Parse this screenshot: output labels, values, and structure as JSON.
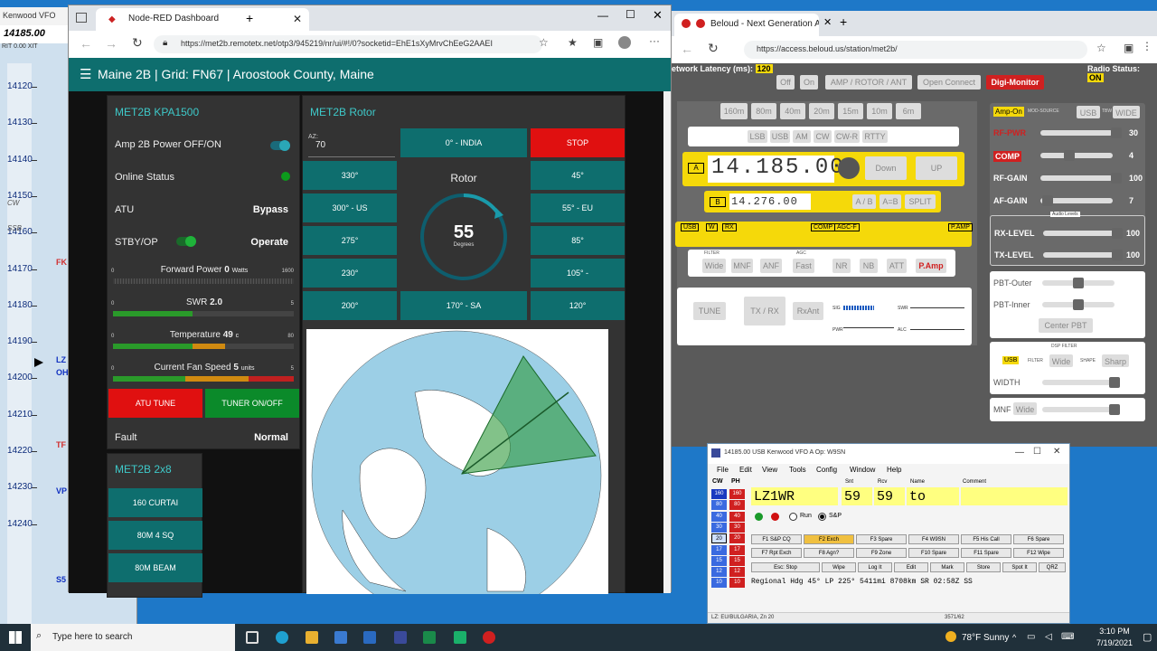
{
  "bandmap": {
    "title": "Kenwood VFO",
    "freq": "14185.00",
    "labels": [
      "RIT",
      "0.00",
      "XIT",
      "0.00"
    ],
    "mhz": [
      "14120",
      "14130",
      "14140",
      "14150",
      "14160",
      "14170",
      "14180",
      "14190",
      "14200",
      "14210",
      "14220",
      "14230",
      "14240"
    ],
    "mode_labels": {
      "cw": "CW",
      "ssb": "SSB"
    },
    "spots": [
      "FK",
      "LZ",
      "OH",
      "TF",
      "VP",
      "S5"
    ]
  },
  "left_browser": {
    "tab_title": "Node-RED Dashboard",
    "url": "https://met2b.remotetx.net/otp3/945219/nr/ui/#!/0?socketid=EhE1sXyMrvChEeG2AAEI",
    "header": "Maine 2B | Grid: FN67 | Aroostook County, Maine",
    "kpa": {
      "title": "MET2B KPA1500",
      "power_label": "Amp 2B Power OFF/ON",
      "online_label": "Online Status",
      "atu_label": "ATU",
      "atu_value": "Bypass",
      "stby_label": "STBY/OP",
      "stby_value": "Operate",
      "fwd_label": "Forward Power",
      "fwd_value": "0",
      "fwd_unit": "Watts",
      "fwd_min": "0",
      "fwd_max": "1600",
      "swr_label": "SWR",
      "swr_value": "2.0",
      "swr_min": "0",
      "swr_max": "5",
      "temp_label": "Temperature",
      "temp_value": "49",
      "temp_unit": "c",
      "temp_min": "0",
      "temp_max": "80",
      "fan_label": "Current Fan Speed",
      "fan_value": "5",
      "fan_unit": "units",
      "fan_min": "0",
      "fan_max": "5",
      "atu_tune": "ATU TUNE",
      "tuner_onoff": "TUNER ON/OFF",
      "fault_label": "Fault",
      "fault_value": "Normal"
    },
    "rotor": {
      "title": "MET2B Rotor",
      "az_label": "AZ:",
      "az_value": "70",
      "center_label": "Rotor",
      "degrees": "55",
      "degrees_unit": "Degrees",
      "stop": "STOP",
      "buttons": [
        "0° - INDIA",
        "330°",
        "45°",
        "300° - US",
        "55° - EU",
        "275°",
        "85°",
        "230°",
        "105° -",
        "200°",
        "170° - SA",
        "120°"
      ]
    },
    "switch": {
      "title": "MET2B 2x8",
      "items": [
        "160 CURTAI",
        "80M 4 SQ",
        "80M BEAM"
      ]
    }
  },
  "right_browser": {
    "tab_title": "Beloud - Next Generation A",
    "url": "https://access.beloud.us/station/met2b/",
    "latency_label": "etwork Latency (ms):",
    "latency_value": "120",
    "radio_status_label": "Radio Status:",
    "radio_status_value": "ON",
    "top_buttons": [
      "Off",
      "On",
      "AMP / ROTOR / ANT",
      "Open Connect",
      "Digi-Monitor"
    ],
    "bands": [
      "160m",
      "80m",
      "40m",
      "20m",
      "15m",
      "10m",
      "6m"
    ],
    "modes": [
      "LSB",
      "USB",
      "AM",
      "CW",
      "CW-R",
      "RTTY"
    ],
    "vfo_a_label": "A",
    "vfo_a_freq": "14.185.00",
    "down": "Down",
    "up": "UP",
    "vfo_b_label": "B",
    "vfo_b_freq": "14.276.00",
    "ab_buttons": [
      "A / B",
      "A=B",
      "SPLIT"
    ],
    "status_flags": [
      "USB",
      "W",
      "RX",
      "COMP",
      "AGC-F",
      "P.AMP"
    ],
    "filter_label": "FILTER",
    "agc_label": "AGC",
    "filter_buttons": [
      "Wide",
      "MNF",
      "ANF",
      "Fast",
      "NR",
      "NB",
      "ATT",
      "P.Amp"
    ],
    "tx_buttons": [
      "TUNE",
      "TX / RX",
      "RxAnt"
    ],
    "meter_labels": [
      "SIG",
      "PWR",
      "SWR",
      "ALC"
    ],
    "amp_on": "Amp-On",
    "mod_source": "MOD-SOURCE",
    "mod_value": "USB",
    "tbw": "TBW",
    "tbw_value": "WIDE",
    "controls": [
      {
        "label": "RF-PWR",
        "value": "30"
      },
      {
        "label": "COMP",
        "value": "4"
      },
      {
        "label": "RF-GAIN",
        "value": "100"
      },
      {
        "label": "AF-GAIN",
        "value": "7"
      }
    ],
    "audio_levels": "Audio Levels",
    "rx_level": "RX-LEVEL",
    "rx_value": "100",
    "tx_level": "TX-LEVEL",
    "tx_value": "100",
    "pbt_outer": "PBT-Outer",
    "pbt_inner": "PBT-Inner",
    "center_pbt": "Center PBT",
    "dsp_filter": "DSP FILTER",
    "dsp_mode": "USB",
    "filter_word": "FILTER",
    "filter_wide": "Wide",
    "shape_word": "SHAPE",
    "shape_value": "Sharp",
    "width_label": "WIDTH",
    "mnf_label": "MNF",
    "mnf_value": "Wide"
  },
  "n1mm": {
    "title": "14185.00 USB Kenwood VFO A   Op: W9SN",
    "menu": [
      "File",
      "Edit",
      "View",
      "Tools",
      "Config",
      "Window",
      "Help"
    ],
    "bands": [
      "160",
      "80",
      "40",
      "30",
      "20",
      "17",
      "15",
      "12",
      "10"
    ],
    "col_cw": "CW",
    "col_ph": "PH",
    "field_labels": [
      "Snt",
      "Rcv",
      "Name",
      "Comment"
    ],
    "call": "LZ1WR",
    "snt": "59",
    "rcv": "59",
    "name": "to",
    "comment": "",
    "run_label": "Run",
    "sp_label": "S&P",
    "fkeys": [
      "F1 S&P CQ",
      "F2 Exch",
      "F3 Spare",
      "F4 W9SN",
      "F5 His Call",
      "F6 Spare",
      "F7 Rpt Exch",
      "F8 Agn?",
      "F9 Zone",
      "F10 Spare",
      "F11 Spare",
      "F12 Wipe"
    ],
    "actions": [
      "Esc: Stop",
      "Wipe",
      "Log It",
      "Edit",
      "Mark",
      "Store",
      "Spot It",
      "QRZ"
    ],
    "info": "Regional Hdg 45° LP 225° 5411mi 8708km SR 02:58Z SS",
    "status_left": "LZ: EU/BULGARIA, Zn 20",
    "status_right": "3571/62"
  },
  "taskbar": {
    "search": "Type here to search",
    "weather": "78°F  Sunny",
    "time": "3:10 PM",
    "date": "7/19/2021"
  }
}
